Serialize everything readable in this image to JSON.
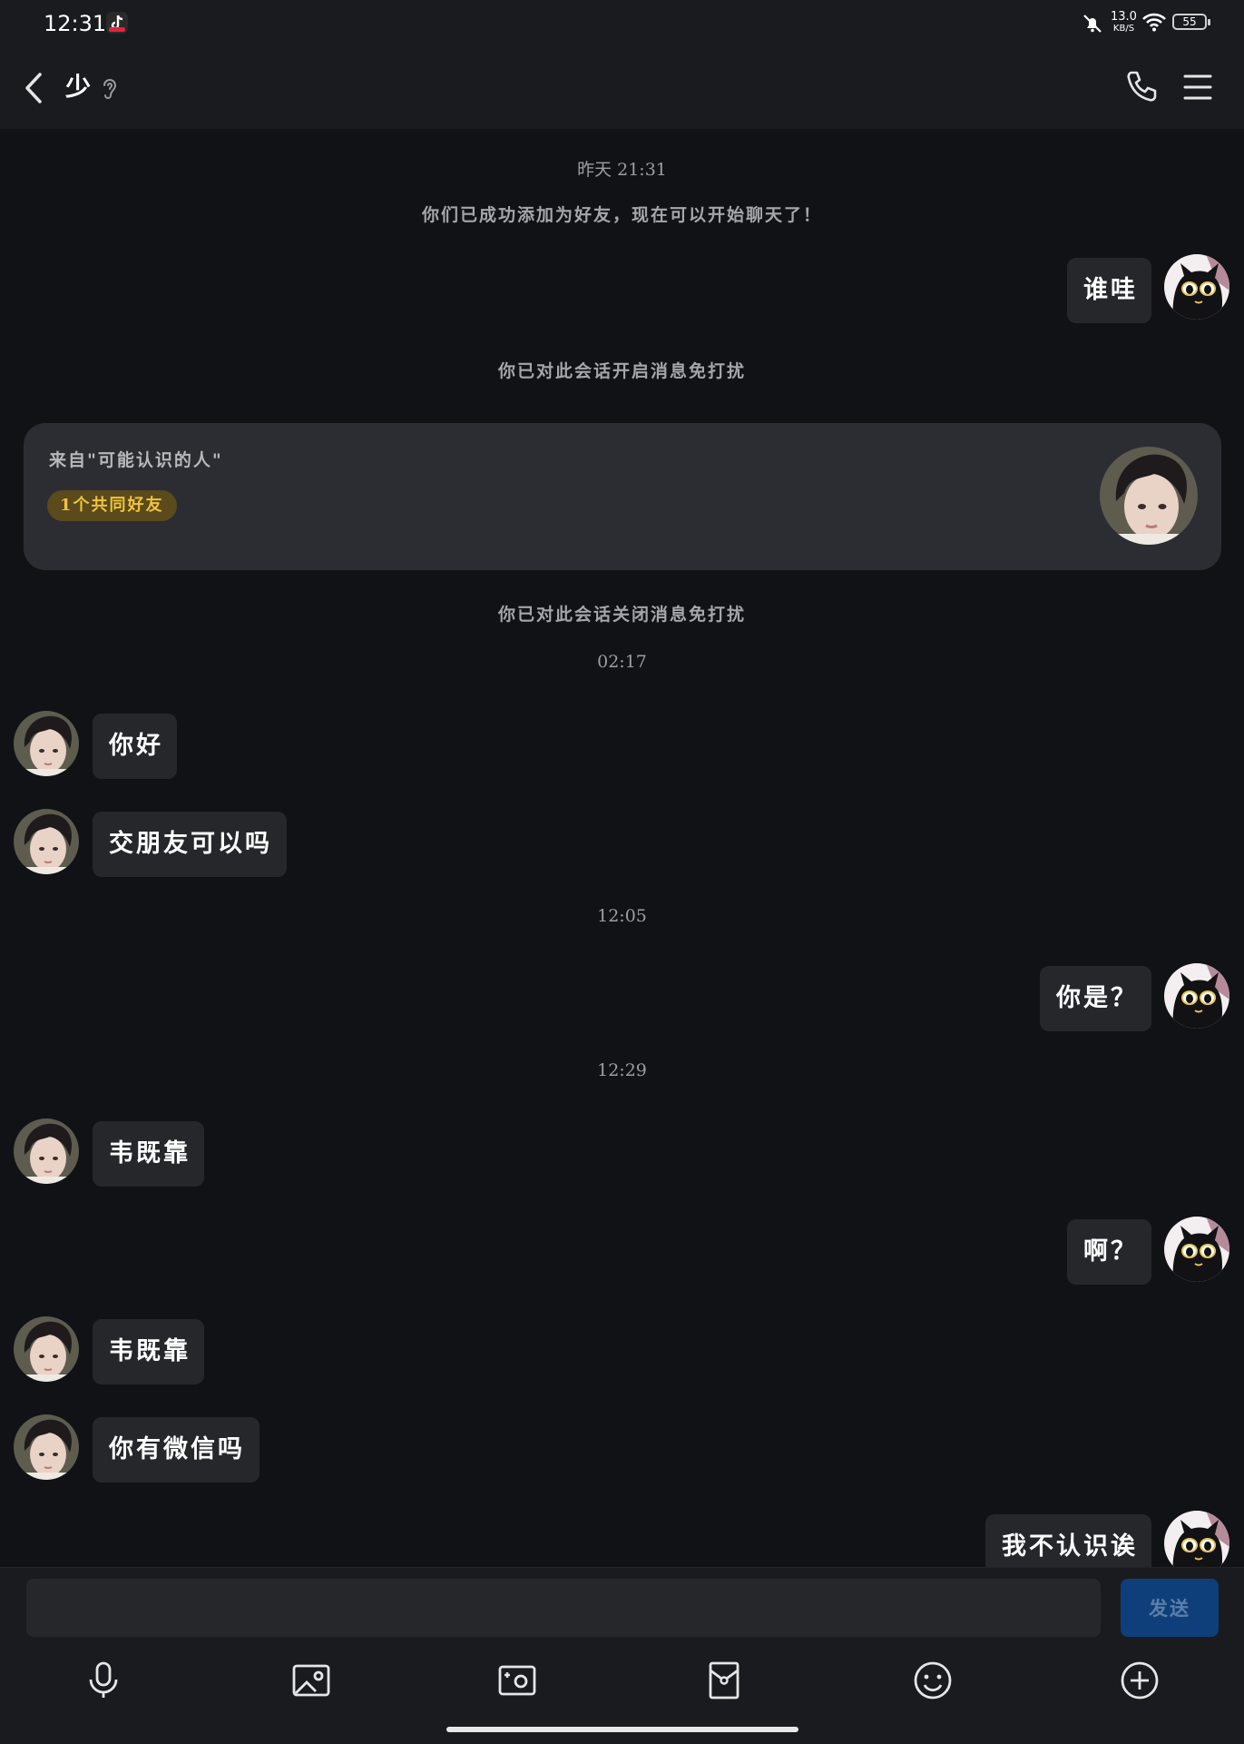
{
  "status_bar": {
    "time": "12:31",
    "net_speed": "13.0",
    "net_unit": "KB/S",
    "battery": "55"
  },
  "header": {
    "contact_name": "少"
  },
  "messages": {
    "ts_yesterday": "昨天 21:31",
    "notice_added": "你们已成功添加为好友，现在可以开始聊天了！",
    "me_1": "谁哇",
    "notice_dnd_on": "你已对此会话开启消息免打扰",
    "notice_dnd_off": "你已对此会话关闭消息免打扰",
    "ts_0217": "02:17",
    "them_1": "你好",
    "them_2": "交朋友可以吗",
    "ts_1205": "12:05",
    "me_2": "你是？",
    "ts_1229": "12:29",
    "them_3": "韦既靠",
    "me_3": "啊？",
    "them_4": "韦既靠",
    "them_5": "你有微信吗",
    "me_4": "我不认识诶"
  },
  "friend_card": {
    "source": "来自\"可能认识的人\"",
    "mutual": "1个共同好友"
  },
  "composer": {
    "input_value": "",
    "send_label": "发送"
  },
  "colors": {
    "background": "#111215",
    "bubble": "#26272b",
    "send_button": "#0e3f7a",
    "badge_text": "#f0c33c"
  }
}
